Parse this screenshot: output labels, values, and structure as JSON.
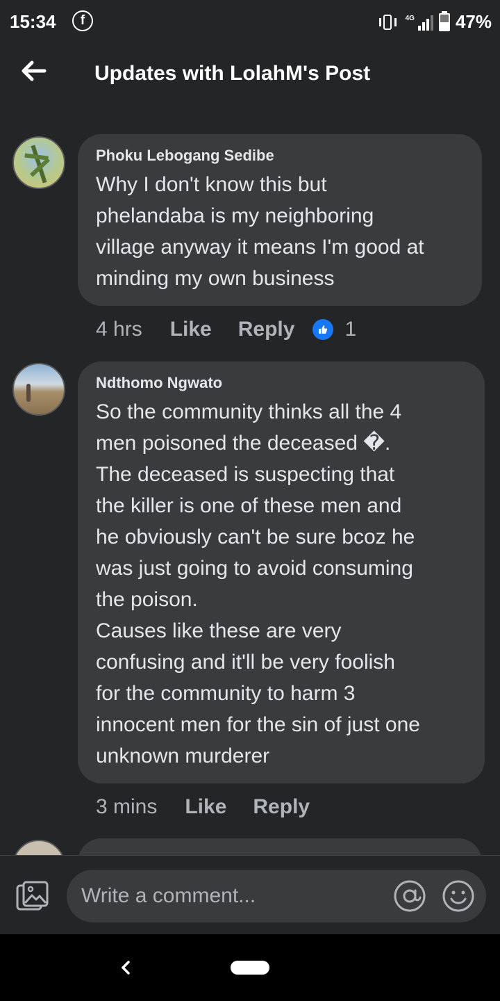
{
  "status_bar": {
    "time": "15:34",
    "network": "4G",
    "battery": "47%",
    "battery_level": 0.47
  },
  "header": {
    "title": "Updates with LolahM's Post"
  },
  "comments": [
    {
      "author": "Phoku Lebogang Sedibe",
      "text": "Why I don't know this but\nphelandaba is my neighboring\nvillage anyway it means I'm good at\nminding my own business",
      "time": "4 hrs",
      "like_label": "Like",
      "reply_label": "Reply",
      "reaction_count": "1"
    },
    {
      "author": "Ndthomo Ngwato",
      "text": "So the community thinks all the 4\nmen poisoned the deceased �.\nThe deceased is suspecting that\nthe killer is one of these men and\nhe obviously can't be sure bcoz he\nwas just going to avoid consuming\nthe poison.\nCauses like these are very\nconfusing and it'll be very foolish\nfor the community to harm 3\ninnocent men for the sin of just one\nunknown murderer",
      "time": "3 mins",
      "like_label": "Like",
      "reply_label": "Reply"
    }
  ],
  "composer": {
    "placeholder": "Write a comment..."
  },
  "icons": {
    "back": "arrow-left",
    "photo": "photo-gallery",
    "mention": "at-sign",
    "emoji": "smiley-face",
    "reaction": "thumbs-up"
  },
  "colors": {
    "background": "#242526",
    "bubble": "#3a3b3c",
    "like_blue": "#1877f2",
    "secondary_text": "#b0b3b8"
  }
}
